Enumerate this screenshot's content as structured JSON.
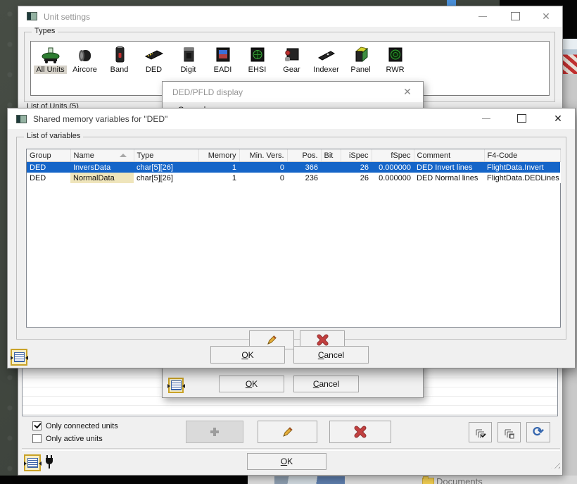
{
  "colors": {
    "selection_blue": "#1565c8",
    "name_highlight": "#efe5bb",
    "delete_red": "#c24040",
    "pencil_gold": "#e4ad3a",
    "refresh_blue": "#3566ae",
    "gold_border": "#c9a227"
  },
  "unit_settings": {
    "title": "Unit settings",
    "window_icon": "app-icon",
    "types_group": {
      "label": "Types",
      "selected_item": "All Units",
      "items": [
        {
          "label": "All Units",
          "icon": "all-units-icon"
        },
        {
          "label": "Aircore",
          "icon": "aircore-icon"
        },
        {
          "label": "Band",
          "icon": "band-icon"
        },
        {
          "label": "DED",
          "icon": "ded-icon"
        },
        {
          "label": "Digit",
          "icon": "digit-icon"
        },
        {
          "label": "EADI",
          "icon": "eadi-icon"
        },
        {
          "label": "EHSI",
          "icon": "ehsi-icon"
        },
        {
          "label": "Gear",
          "icon": "gear-icon"
        },
        {
          "label": "Indexer",
          "icon": "indexer-icon"
        },
        {
          "label": "Panel",
          "icon": "panel-icon"
        },
        {
          "label": "RWR",
          "icon": "rwr-icon"
        }
      ]
    },
    "list_label": "List of Units (5)",
    "filters": [
      {
        "label": "Only connected units",
        "checked": true
      },
      {
        "label": "Only active units",
        "checked": false
      }
    ],
    "toolbar_icons": [
      "add-icon",
      "edit-pencil-icon",
      "delete-x-icon",
      "select-connected-icon",
      "select-all-icon",
      "refresh-icon"
    ],
    "ok_label": "OK"
  },
  "ded_pfld_dialog": {
    "title": "DED/PFLD display",
    "general_label": "General",
    "ok_label": "OK",
    "cancel_label": "Cancel"
  },
  "shared_dialog": {
    "title": "Shared memory variables for \"DED\"",
    "group_label": "List of variables",
    "table": {
      "columns": [
        "Group",
        "Name",
        "Type",
        "Memory",
        "Min. Vers.",
        "Pos.",
        "Bit",
        "iSpec",
        "fSpec",
        "Comment",
        "F4-Code"
      ],
      "sorted_column": "Name",
      "rows": [
        {
          "group": "DED",
          "name": "InversData",
          "type": "char[5][26]",
          "memory": "1",
          "min_vers": "0",
          "pos": "366",
          "bit": "",
          "ispec": "26",
          "fspec": "0.000000",
          "comment": "DED Invert lines",
          "f4code": "FlightData.Invert"
        },
        {
          "group": "DED",
          "name": "NormalData",
          "type": "char[5][26]",
          "memory": "1",
          "min_vers": "0",
          "pos": "236",
          "bit": "",
          "ispec": "26",
          "fspec": "0.000000",
          "comment": "DED Normal lines",
          "f4code": "FlightData.DEDLines"
        }
      ]
    },
    "ok_label": "OK",
    "cancel_label": "Cancel"
  },
  "background": {
    "documents_label": "Documents"
  }
}
